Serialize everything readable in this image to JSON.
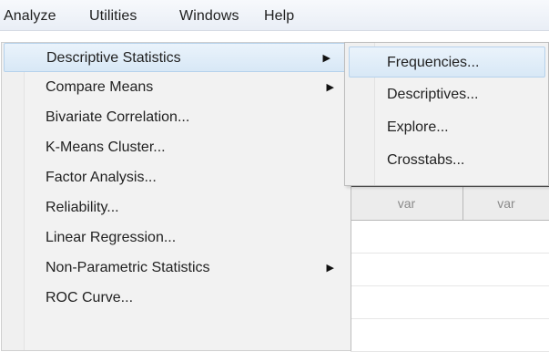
{
  "menubar": {
    "items": [
      {
        "label": "Analyze",
        "mnemonic": "A",
        "rest": "nalyze"
      },
      {
        "label": "Utilities",
        "mnemonic": "U",
        "rest": "tilities"
      },
      {
        "label": "Windows",
        "mnemonic": "W",
        "rest": "indows"
      },
      {
        "label": "Help",
        "mnemonic": "H",
        "rest": "elp"
      }
    ]
  },
  "analyze_menu": {
    "items": [
      {
        "label": "Descriptive Statistics",
        "has_submenu": true
      },
      {
        "label": "Compare Means",
        "has_submenu": true
      },
      {
        "label": "Bivariate Correlation...",
        "has_submenu": false
      },
      {
        "label": "K-Means Cluster...",
        "has_submenu": false
      },
      {
        "label": "Factor Analysis...",
        "has_submenu": false
      },
      {
        "label": "Reliability...",
        "has_submenu": false
      },
      {
        "label": "Linear Regression...",
        "has_submenu": false
      },
      {
        "label": "Non-Parametric Statistics",
        "has_submenu": true
      },
      {
        "label": "ROC Curve...",
        "has_submenu": false
      }
    ],
    "submenu_arrow": "▶"
  },
  "descriptive_submenu": {
    "items": [
      {
        "label": "Frequencies..."
      },
      {
        "label": "Descriptives..."
      },
      {
        "label": "Explore..."
      },
      {
        "label": "Crosstabs..."
      }
    ]
  },
  "data_grid": {
    "columns": [
      "var",
      "var"
    ]
  },
  "colors": {
    "highlight": "#d8e8f6",
    "highlight_border": "#b6d2ec",
    "menu_bg": "#f2f2f2"
  }
}
